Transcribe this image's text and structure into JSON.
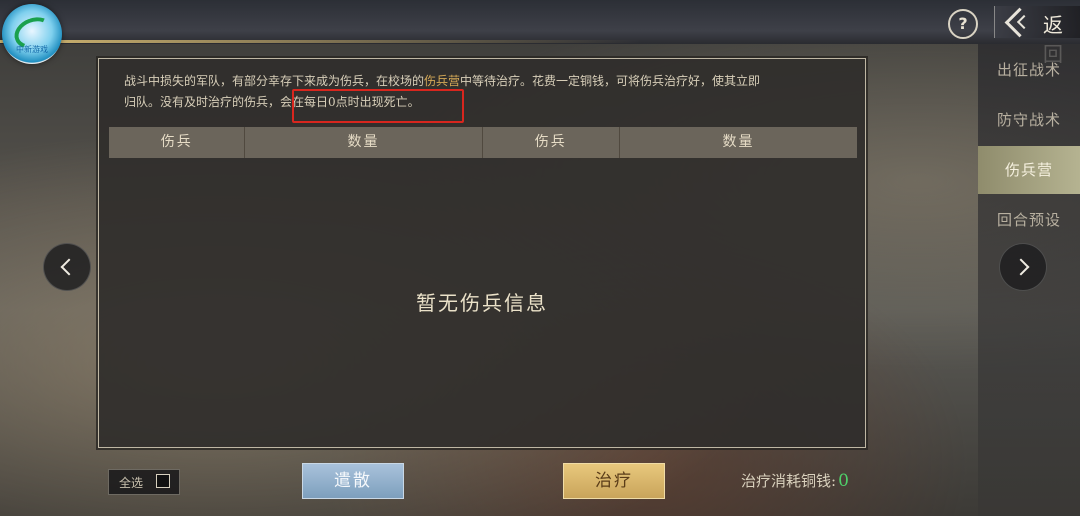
{
  "logo": {
    "text": "中新游戏"
  },
  "header": {
    "help_label": "?",
    "back_label": "返回"
  },
  "side_tabs": [
    {
      "label": "出征战术",
      "active": false
    },
    {
      "label": "防守战术",
      "active": false
    },
    {
      "label": "伤兵营",
      "active": true
    },
    {
      "label": "回合预设",
      "active": false
    }
  ],
  "description": {
    "line1_a": "战斗中损失的军队，有部分幸存下来成为伤兵，在校场的",
    "line1_hl": "伤兵营",
    "line1_b": "中等待治疗。花费一定铜钱，可将伤兵治疗好，使其立即",
    "line2_a": "归队。没有及时治疗的伤兵，",
    "line2_b": "会在每日0点时出现死亡。"
  },
  "table": {
    "headers": [
      "伤兵",
      "数量",
      "伤兵",
      "数量"
    ]
  },
  "empty_message": "暂无伤兵信息",
  "footer": {
    "select_all_label": "全选",
    "dismiss_label": "遣散",
    "heal_label": "治疗",
    "cost_label": "治疗消耗铜钱:",
    "cost_value": "0"
  },
  "colors": {
    "highlight": "#d5a957",
    "cost_value": "#4fd06a",
    "active_tab": "#b5b391",
    "red_box": "#d8261e"
  }
}
